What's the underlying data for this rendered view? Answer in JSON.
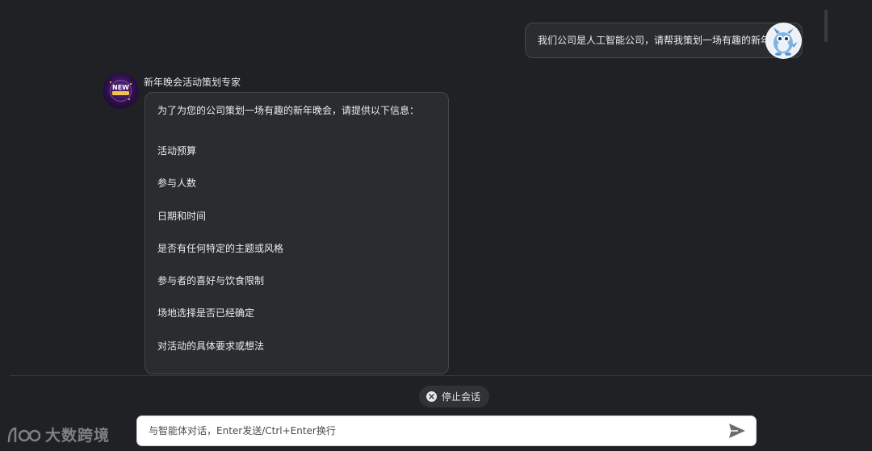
{
  "conversation": {
    "user_message": "我们公司是人工智能公司，请帮我策划一场有趣的新年晚会",
    "agent": {
      "name": "新年晚会活动策划专家",
      "avatar_text": "NEW",
      "intro": "为了为您的公司策划一场有趣的新年晚会，请提供以下信息：",
      "items": [
        "活动预算",
        "参与人数",
        "日期和时间",
        "是否有任何特定的主题或风格",
        "参与者的喜好与饮食限制",
        "场地选择是否已经确定",
        "对活动的具体要求或想法"
      ]
    }
  },
  "controls": {
    "stop_label": "停止会话",
    "input_placeholder": "与智能体对话，Enter发送/Ctrl+Enter换行"
  },
  "watermark": {
    "text": "大数跨境"
  },
  "icons": {
    "stop": "close-circle-icon",
    "send": "send-icon",
    "user_avatar": "robot-mascot-avatar",
    "agent_avatar": "new-year-badge-avatar"
  }
}
